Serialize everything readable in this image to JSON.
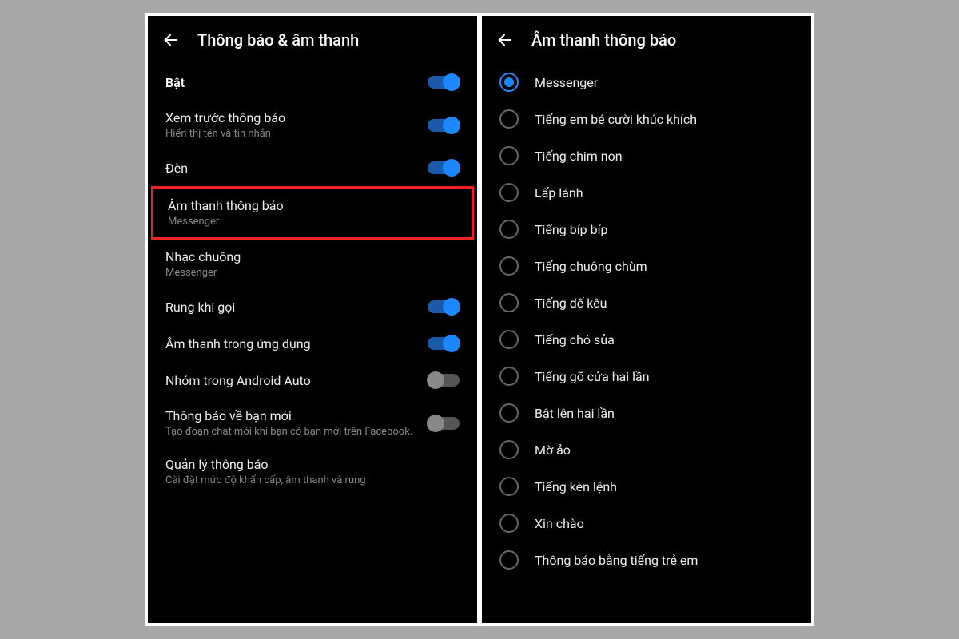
{
  "left": {
    "title": "Thông báo & âm thanh",
    "items": [
      {
        "title": "Bật",
        "subtitle": "",
        "toggle": true,
        "on": true,
        "bold": true
      },
      {
        "title": "Xem trước thông báo",
        "subtitle": "Hiển thị tên và tin nhắn",
        "toggle": true,
        "on": true
      },
      {
        "title": "Đèn",
        "subtitle": "",
        "toggle": true,
        "on": true
      },
      {
        "title": "Âm thanh thông báo",
        "subtitle": "Messenger",
        "toggle": false,
        "highlight": true
      },
      {
        "title": "Nhạc chuông",
        "subtitle": "Messenger",
        "toggle": false
      },
      {
        "title": "Rung khi gọi",
        "subtitle": "",
        "toggle": true,
        "on": true
      },
      {
        "title": "Âm thanh trong ứng dụng",
        "subtitle": "",
        "toggle": true,
        "on": true
      },
      {
        "title": "Nhóm trong Android Auto",
        "subtitle": "",
        "toggle": true,
        "on": false
      },
      {
        "title": "Thông báo về bạn mới",
        "subtitle": "Tạo đoạn chat mới khi bạn có bạn mới trên Facebook.",
        "toggle": true,
        "on": false
      },
      {
        "title": "Quản lý thông báo",
        "subtitle": "Cài đặt mức độ khẩn cấp, âm thanh và rung",
        "toggle": false
      }
    ]
  },
  "right": {
    "title": "Âm thanh thông báo",
    "options": [
      {
        "label": "Messenger",
        "selected": true
      },
      {
        "label": "Tiếng em bé cười khúc khích",
        "selected": false
      },
      {
        "label": "Tiếng chim non",
        "selected": false
      },
      {
        "label": "Lấp lánh",
        "selected": false
      },
      {
        "label": "Tiếng bíp bíp",
        "selected": false
      },
      {
        "label": "Tiếng chuông chùm",
        "selected": false
      },
      {
        "label": "Tiếng dế kêu",
        "selected": false
      },
      {
        "label": "Tiếng chó sủa",
        "selected": false
      },
      {
        "label": "Tiếng gõ cửa hai lần",
        "selected": false
      },
      {
        "label": "Bật lên hai lần",
        "selected": false
      },
      {
        "label": "Mờ ảo",
        "selected": false
      },
      {
        "label": "Tiếng kèn lệnh",
        "selected": false
      },
      {
        "label": "Xin chào",
        "selected": false
      },
      {
        "label": "Thông báo bằng tiếng trẻ em",
        "selected": false
      }
    ]
  }
}
